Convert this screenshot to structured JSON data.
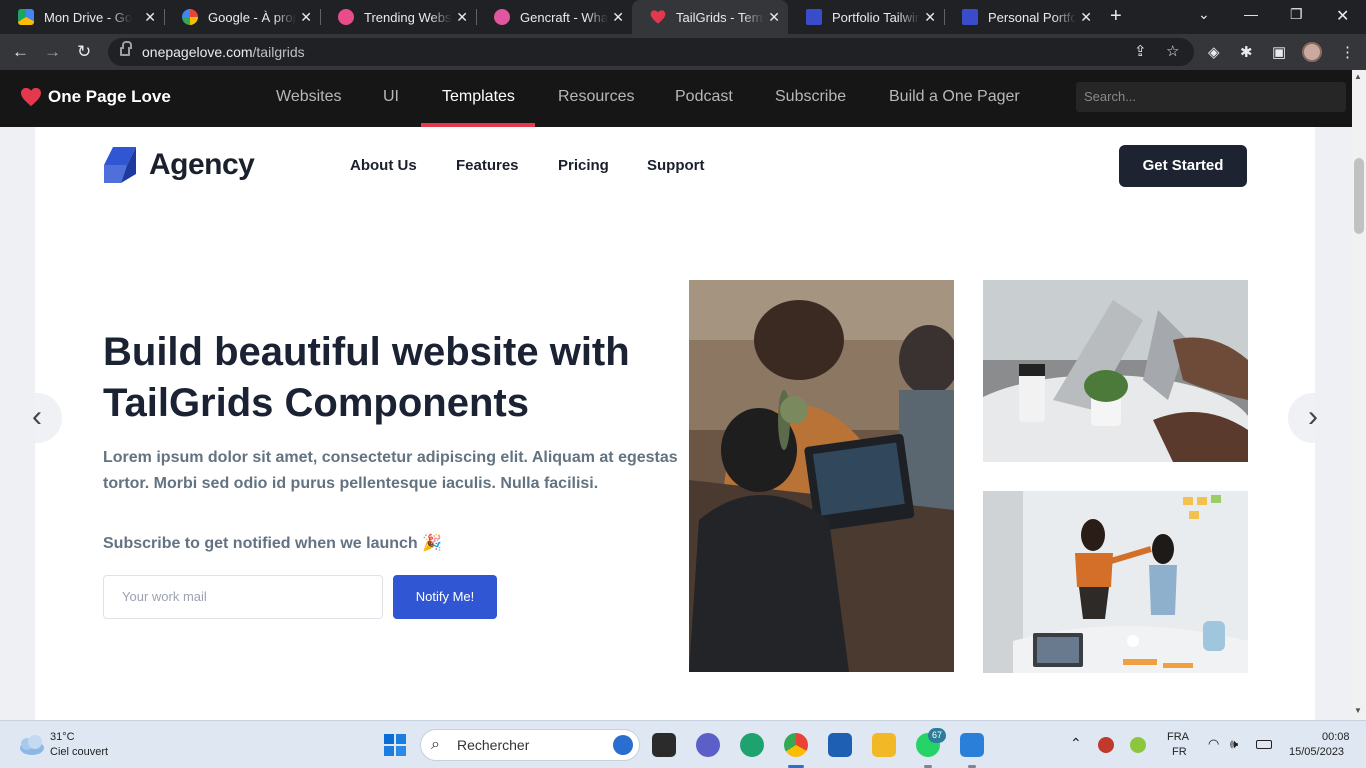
{
  "browser": {
    "tabs": [
      {
        "label": "Mon Drive - Google Drive",
        "color": "#1fa463"
      },
      {
        "label": "Google - À propos",
        "color": "#4285f4"
      },
      {
        "label": "Trending Websites",
        "color": "#ea4c89"
      },
      {
        "label": "Gencraft - What will you create",
        "color": "#e056a0"
      },
      {
        "label": "TailGrids - Templates",
        "color": "#e4384e"
      },
      {
        "label": "Portfolio Tailwind",
        "color": "#3b4cca"
      },
      {
        "label": "Personal Portfolio",
        "color": "#3b4cca"
      }
    ],
    "new_tab": "+",
    "url_domain": "onepagelove.com",
    "url_path": "/tailgrids"
  },
  "opl": {
    "brand": "One Page Love",
    "nav": [
      "Websites",
      "UI",
      "Templates",
      "Resources",
      "Podcast",
      "Subscribe",
      "Build a One Pager"
    ],
    "active": "Templates",
    "search_placeholder": "Search..."
  },
  "agency": {
    "brand": "Agency",
    "nav": [
      "About Us",
      "Features",
      "Pricing",
      "Support"
    ],
    "cta": "Get Started",
    "hero_title": "Build beautiful website with TailGrids Components",
    "hero_desc": "Lorem ipsum dolor sit amet, consectetur adipiscing elit. Aliquam at egestas tortor. Morbi sed odio id purus pellentesque iaculis. Nulla facilisi.",
    "subscribe_label": "Subscribe to get notified when we launch 🎉",
    "email_placeholder": "Your work mail",
    "notify_label": "Notify Me!"
  },
  "taskbar": {
    "temp": "31°C",
    "weather": "Ciel couvert",
    "search": "Rechercher",
    "whatsapp_badge": "67",
    "lang1": "FRA",
    "lang2": "FR",
    "time": "00:08",
    "date": "15/05/2023"
  }
}
